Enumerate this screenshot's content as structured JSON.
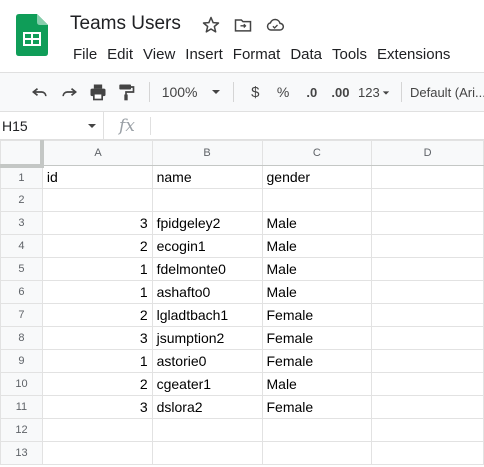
{
  "app": {
    "doc_title": "Teams Users",
    "brand_color": "#0f9d58"
  },
  "menu": [
    "File",
    "Edit",
    "View",
    "Insert",
    "Format",
    "Data",
    "Tools",
    "Extensions"
  ],
  "toolbar": {
    "zoom": "100%",
    "currency": "$",
    "percent": "%",
    "decrease_decimal": ".0",
    "increase_decimal": ".00",
    "number_format": "123",
    "font": "Default (Ari..."
  },
  "formula_bar": {
    "cell_ref": "H15",
    "fx": "fx",
    "content": ""
  },
  "sheet": {
    "columns": [
      "A",
      "B",
      "C",
      "D"
    ],
    "rows": [
      {
        "n": "1",
        "cells": [
          "id",
          "name",
          "gender",
          ""
        ]
      },
      {
        "n": "2",
        "cells": [
          "",
          "",
          "",
          ""
        ]
      },
      {
        "n": "3",
        "cells": [
          "3",
          "fpidgeley2",
          "Male",
          ""
        ]
      },
      {
        "n": "4",
        "cells": [
          "2",
          "ecogin1",
          "Male",
          ""
        ]
      },
      {
        "n": "5",
        "cells": [
          "1",
          "fdelmonte0",
          "Male",
          ""
        ]
      },
      {
        "n": "6",
        "cells": [
          "1",
          "ashafto0",
          "Male",
          ""
        ]
      },
      {
        "n": "7",
        "cells": [
          "2",
          "lgladtbach1",
          "Female",
          ""
        ]
      },
      {
        "n": "8",
        "cells": [
          "3",
          "jsumption2",
          "Female",
          ""
        ]
      },
      {
        "n": "9",
        "cells": [
          "1",
          "astorie0",
          "Female",
          ""
        ]
      },
      {
        "n": "10",
        "cells": [
          "2",
          "cgeater1",
          "Male",
          ""
        ]
      },
      {
        "n": "11",
        "cells": [
          "3",
          "dslora2",
          "Female",
          ""
        ]
      },
      {
        "n": "12",
        "cells": [
          "",
          "",
          "",
          ""
        ]
      },
      {
        "n": "13",
        "cells": [
          "",
          "",
          "",
          ""
        ]
      }
    ]
  }
}
